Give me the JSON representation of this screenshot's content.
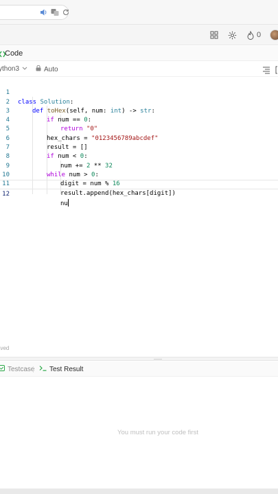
{
  "browser": {
    "icons": [
      "speaker-icon",
      "translate-icon",
      "reload-icon"
    ]
  },
  "header": {
    "icons": [
      "layout-icon",
      "settings-icon",
      "streak-icon"
    ],
    "streak_count": "0"
  },
  "code_panel": {
    "tab_label": "Code",
    "language": "ython3",
    "mode": "Auto"
  },
  "editor": {
    "lines": [
      {
        "n": "1",
        "indent": 0
      },
      {
        "n": "2",
        "indent": 1
      },
      {
        "n": "3",
        "indent": 2
      },
      {
        "n": "4",
        "indent": 3
      },
      {
        "n": "5",
        "indent": 2
      },
      {
        "n": "6",
        "indent": 2
      },
      {
        "n": "7",
        "indent": 2
      },
      {
        "n": "8",
        "indent": 3
      },
      {
        "n": "9",
        "indent": 2
      },
      {
        "n": "10",
        "indent": 3
      },
      {
        "n": "11",
        "indent": 3
      },
      {
        "n": "12",
        "indent": 3
      }
    ],
    "tokens": {
      "l1": [
        "class",
        " ",
        "Solution",
        ":"
      ],
      "l2": [
        "def",
        " ",
        "toHex",
        "(self, num: ",
        "int",
        ") -> ",
        "str",
        ":"
      ],
      "l3": [
        "if",
        " num == ",
        "0",
        ":"
      ],
      "l4": [
        "return",
        " ",
        "\"0\""
      ],
      "l5": [
        "hex_chars = ",
        "\"0123456789abcdef\""
      ],
      "l6": [
        "result = []"
      ],
      "l7": [
        "if",
        " num < ",
        "0",
        ":"
      ],
      "l8": [
        "num += ",
        "2",
        " ** ",
        "32"
      ],
      "l9": [
        "while",
        " num > ",
        "0",
        ":"
      ],
      "l10": [
        "digit = num % ",
        "16"
      ],
      "l11": [
        "result.append(hex_chars[digit])"
      ],
      "l12": [
        "nu"
      ]
    },
    "save_status": "aved"
  },
  "bottom_panel": {
    "tab_testcase": "Testcase",
    "tab_result": "Test Result",
    "empty_message": "You must run your code first"
  },
  "colors": {
    "keyword": "#af00db",
    "def_keyword": "#0000ff",
    "class_name": "#267f99",
    "function": "#795e26",
    "number": "#098658",
    "string": "#a31515",
    "line_number": "#237893",
    "testcase_icon": "#28a745"
  }
}
